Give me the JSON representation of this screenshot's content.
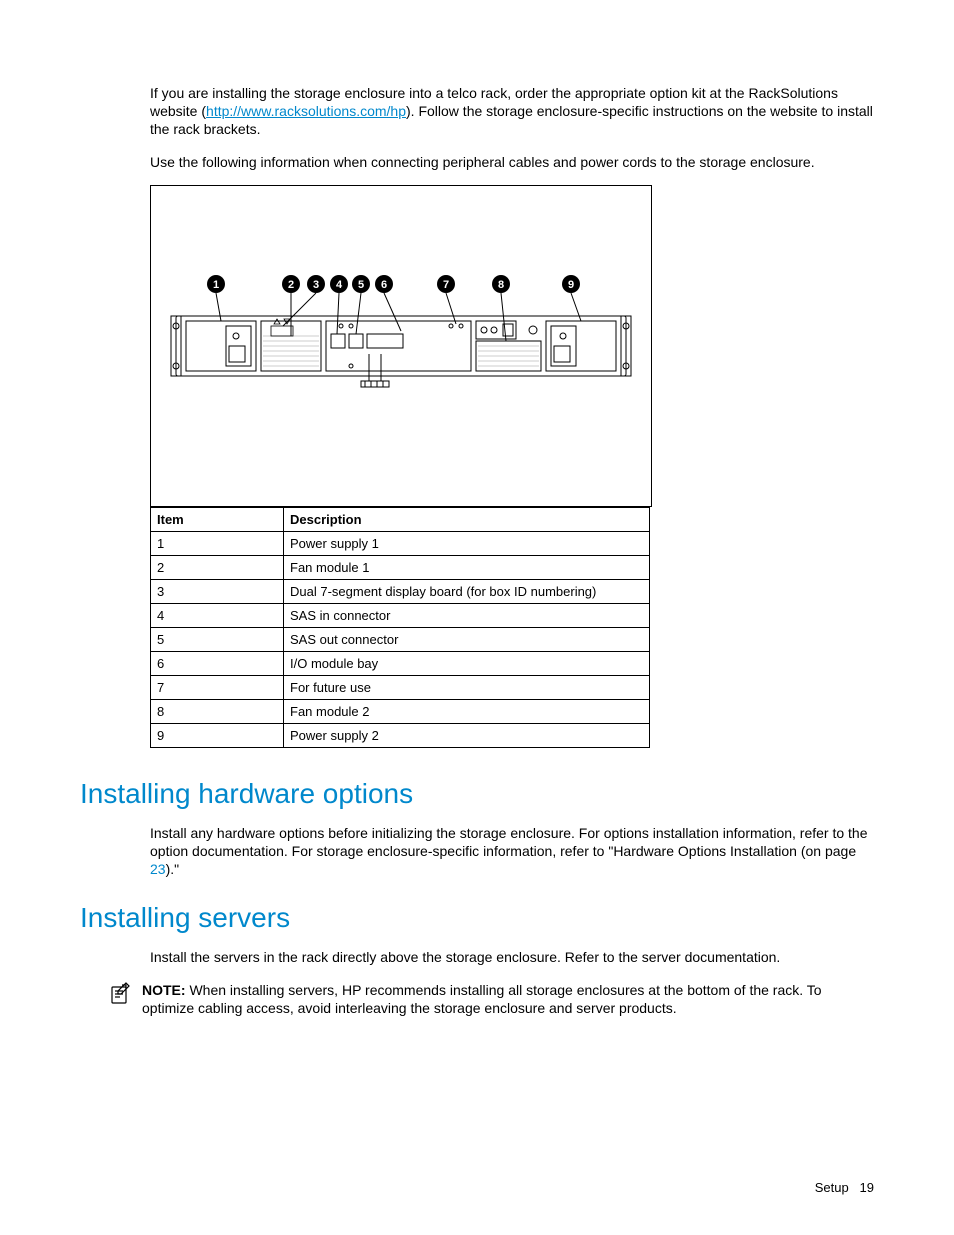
{
  "intro": {
    "para1_a": "If you are installing the storage enclosure into a telco rack, order the appropriate option kit at the RackSolutions website (",
    "link": "http://www.racksolutions.com/hp",
    "para1_b": "). Follow the storage enclosure-specific instructions on the website to install the rack brackets.",
    "para2": "Use the following information when connecting peripheral cables and power cords to the storage enclosure."
  },
  "callouts": [
    "1",
    "2",
    "3",
    "4",
    "5",
    "6",
    "7",
    "8",
    "9"
  ],
  "table": {
    "head_item": "Item",
    "head_desc": "Description",
    "rows": [
      {
        "item": "1",
        "desc": "Power supply 1"
      },
      {
        "item": "2",
        "desc": "Fan module 1"
      },
      {
        "item": "3",
        "desc": "Dual 7-segment display board (for box ID numbering)"
      },
      {
        "item": "4",
        "desc": "SAS in connector"
      },
      {
        "item": "5",
        "desc": "SAS out connector"
      },
      {
        "item": "6",
        "desc": "I/O module bay"
      },
      {
        "item": "7",
        "desc": "For future use"
      },
      {
        "item": "8",
        "desc": "Fan module 2"
      },
      {
        "item": "9",
        "desc": "Power supply 2"
      }
    ]
  },
  "hw_options": {
    "heading": "Installing hardware options",
    "para_a": "Install any hardware options before initializing the storage enclosure. For options installation information, refer to the option documentation. For storage enclosure-specific information, refer to \"Hardware Options Installation (on page ",
    "page_link": "23",
    "para_b": ").\""
  },
  "servers": {
    "heading": "Installing servers",
    "para": "Install the servers in the rack directly above the storage enclosure. Refer to the server documentation.",
    "note_label": "NOTE:",
    "note_text": "  When installing servers, HP recommends installing all storage enclosures at the bottom of the rack. To optimize cabling access, avoid interleaving the storage enclosure and server products."
  },
  "footer": {
    "section": "Setup",
    "page": "19"
  }
}
